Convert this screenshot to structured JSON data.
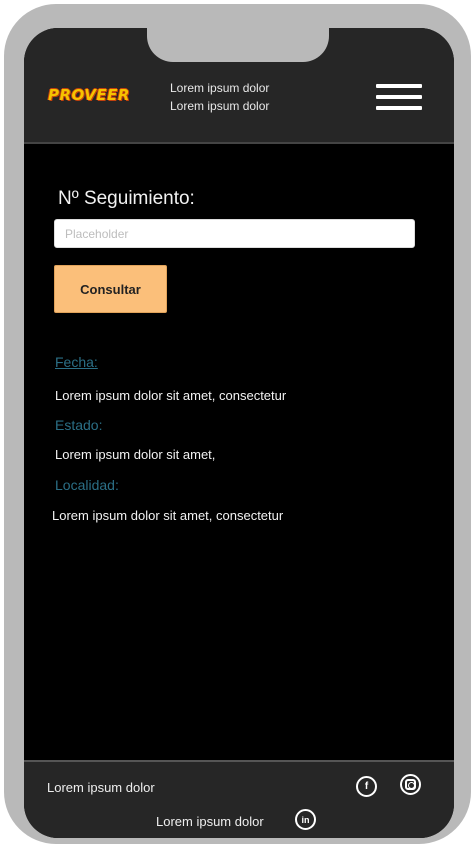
{
  "header": {
    "logo_text": "PROVEER",
    "line1": "Lorem ipsum dolor",
    "line2": "Lorem ipsum dolor",
    "menu_icon": "hamburger-icon"
  },
  "tracking": {
    "label": "Nº Seguimiento:",
    "placeholder": "Placeholder",
    "value": "",
    "button_label": "Consultar"
  },
  "result": {
    "fecha_label": "Fecha:",
    "fecha_value": "Lorem ipsum dolor sit amet, consectetur",
    "estado_label": "Estado:",
    "estado_value": "Lorem ipsum dolor sit amet,",
    "localidad_label": "Localidad:",
    "localidad_value": "Lorem ipsum dolor sit amet, consectetur"
  },
  "footer": {
    "text1": "Lorem ipsum dolor",
    "text2": "Lorem ipsum dolor",
    "facebook_glyph": "f",
    "linkedin_glyph": "in",
    "icons": [
      "facebook-icon",
      "instagram-icon",
      "linkedin-icon"
    ]
  },
  "colors": {
    "accent_button": "#fbbf7a",
    "label_blue": "#2b6f86",
    "logo_yellow": "#f5c400",
    "bar_gray": "#262626"
  }
}
